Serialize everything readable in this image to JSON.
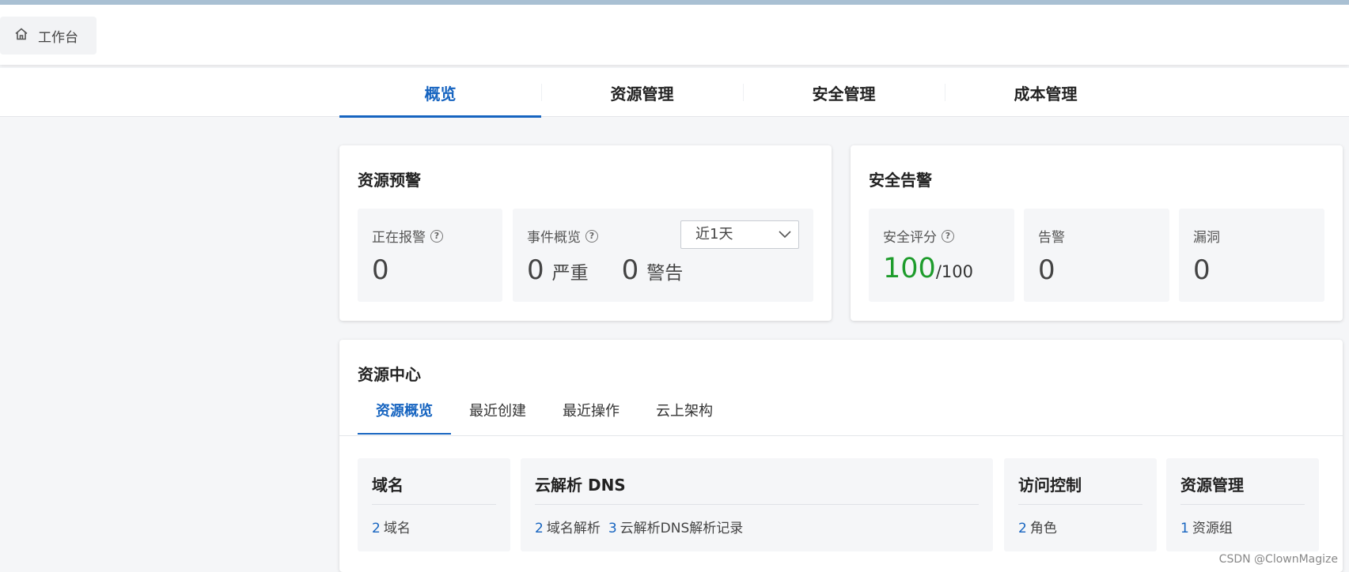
{
  "header": {
    "home_tab_label": "工作台"
  },
  "main_tabs": [
    {
      "label": "概览",
      "active": true
    },
    {
      "label": "资源管理"
    },
    {
      "label": "安全管理"
    },
    {
      "label": "成本管理"
    }
  ],
  "resource_alert": {
    "title": "资源预警",
    "alerting": {
      "label": "正在报警",
      "value": "0"
    },
    "events": {
      "label": "事件概览",
      "range_selected": "近1天",
      "critical_count": "0",
      "critical_label": "严重",
      "warning_count": "0",
      "warning_label": "警告"
    }
  },
  "security_alert": {
    "title": "安全告警",
    "score": {
      "label": "安全评分",
      "value": "100",
      "max": "/100"
    },
    "alerts": {
      "label": "告警",
      "value": "0"
    },
    "vulns": {
      "label": "漏洞",
      "value": "0"
    }
  },
  "resource_center": {
    "title": "资源中心",
    "tabs": [
      {
        "label": "资源概览",
        "active": true
      },
      {
        "label": "最近创建"
      },
      {
        "label": "最近操作"
      },
      {
        "label": "云上架构"
      }
    ],
    "boxes": {
      "domain": {
        "title": "域名",
        "items": [
          {
            "count": "2",
            "label": "域名"
          }
        ]
      },
      "dns": {
        "title": "云解析 DNS",
        "items": [
          {
            "count": "2",
            "label": "域名解析"
          },
          {
            "count": "3",
            "label": "云解析DNS解析记录"
          }
        ]
      },
      "access": {
        "title": "访问控制",
        "items": [
          {
            "count": "2",
            "label": "角色"
          }
        ]
      },
      "resource_mgmt": {
        "title": "资源管理",
        "items": [
          {
            "count": "1",
            "label": "资源组"
          }
        ]
      }
    }
  },
  "watermark": "CSDN @ClownMagize",
  "colors": {
    "accent": "#1664c0",
    "score_green": "#1e9c2c"
  }
}
